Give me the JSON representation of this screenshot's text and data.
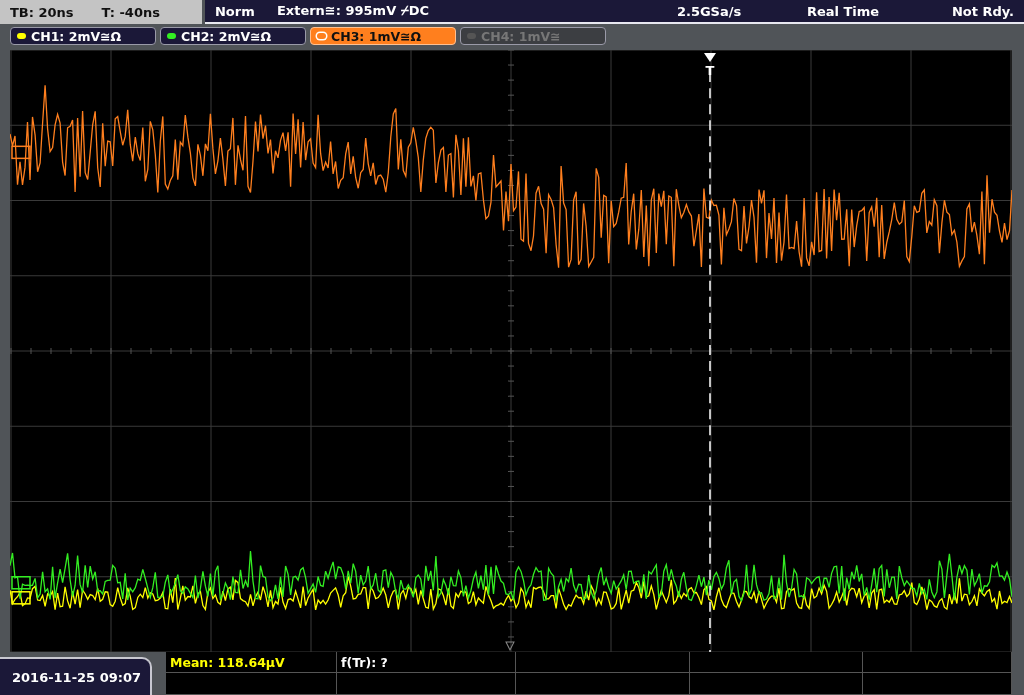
{
  "header": {
    "timebase": "TB: 20ns",
    "trigger_time": "T: -40ns",
    "trigger_mode": "Norm",
    "trigger_source": "Extern≅: 995mV ⌿DC",
    "sample_rate": "2.5GSa/s",
    "acquisition": "Real Time",
    "status": "Not Rdy."
  },
  "channels": [
    {
      "label": "CH1: 2mV≅Ω",
      "color": "#ffff00",
      "selected": false,
      "disabled": false
    },
    {
      "label": "CH2: 2mV≅Ω",
      "color": "#33ee22",
      "selected": false,
      "disabled": false
    },
    {
      "label": "CH3: 1mV≅Ω",
      "color": "#ff7f1e",
      "selected": true,
      "disabled": false
    },
    {
      "label": "CH4: 1mV≅",
      "color": "#555555",
      "selected": false,
      "disabled": true
    }
  ],
  "trigger_marker": "T",
  "date": "2016-11-25 09:07",
  "measurements": [
    {
      "text": "Mean: 118.64µV",
      "color": "#ffff00"
    },
    {
      "text": "f(Tr): ?",
      "color": "#ffffff"
    }
  ]
}
